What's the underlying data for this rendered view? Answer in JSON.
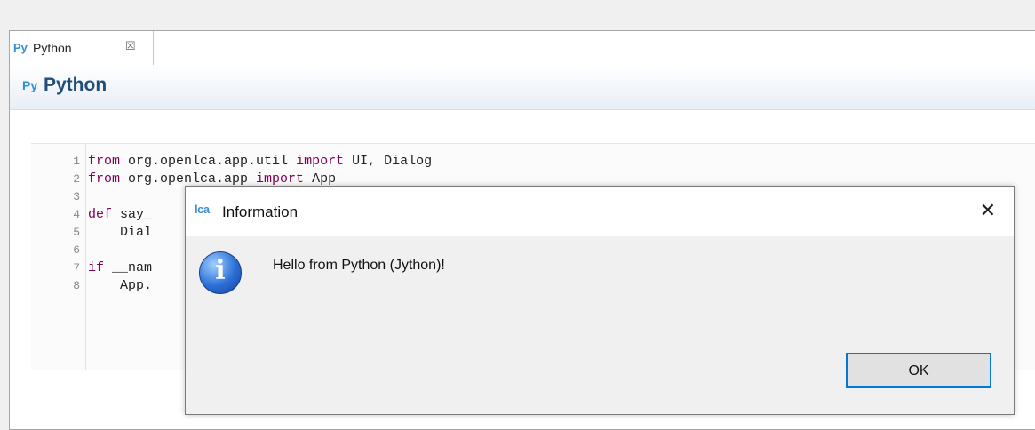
{
  "tab": {
    "icon": "python-icon",
    "icon_text": "Py",
    "label": "Python",
    "close_glyph": "☒"
  },
  "header": {
    "icon": "python-icon",
    "icon_text": "Py",
    "title": "Python"
  },
  "code": {
    "lines": [
      {
        "num": "1",
        "parts": [
          {
            "t": "from",
            "kw": true
          },
          {
            "t": " org.openlca.app.util "
          },
          {
            "t": "import",
            "kw": true
          },
          {
            "t": " UI, Dialog"
          }
        ]
      },
      {
        "num": "2",
        "parts": [
          {
            "t": "from",
            "kw": true
          },
          {
            "t": " org.openlca.app "
          },
          {
            "t": "import",
            "kw": true
          },
          {
            "t": " App"
          }
        ]
      },
      {
        "num": "3",
        "parts": []
      },
      {
        "num": "4",
        "parts": [
          {
            "t": "def",
            "kw": true
          },
          {
            "t": " say_"
          }
        ]
      },
      {
        "num": "5",
        "parts": [
          {
            "t": "    Dial"
          }
        ]
      },
      {
        "num": "6",
        "parts": []
      },
      {
        "num": "7",
        "parts": [
          {
            "t": "if",
            "kw": true
          },
          {
            "t": " __nam"
          }
        ]
      },
      {
        "num": "8",
        "parts": [
          {
            "t": "    App."
          }
        ]
      }
    ]
  },
  "dialog": {
    "logo_text": "lca",
    "title": "Information",
    "close_glyph": "✕",
    "message": "Hello from Python (Jython)!",
    "ok_label": "OK",
    "icon": "information-icon",
    "icon_glyph": "i"
  },
  "colors": {
    "accent": "#0078d7",
    "keyword": "#7f0055",
    "python_icon": "#2f8fd8"
  }
}
